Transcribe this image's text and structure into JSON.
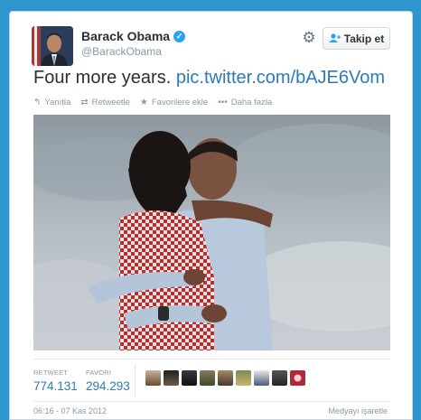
{
  "user": {
    "name": "Barack Obama",
    "handle": "@BarackObama",
    "verified_icon": "verified-badge-icon"
  },
  "header": {
    "follow_label": "Takip et",
    "gear_icon": "gear-icon"
  },
  "tweet": {
    "text": "Four more years.",
    "link": "pic.twitter.com/bAJE6Vom"
  },
  "actions": [
    {
      "icon": "reply-icon",
      "label": "Yanıtla"
    },
    {
      "icon": "retweet-icon",
      "label": "Retweetle"
    },
    {
      "icon": "star-icon",
      "label": "Favorilere ekle"
    },
    {
      "icon": "more-icon",
      "label": "Daha fazla"
    }
  ],
  "stats": {
    "retweet_label": "RETWEET",
    "retweet_count": "774.131",
    "favorite_label": "FAVORI",
    "favorite_count": "294.293"
  },
  "footer": {
    "timestamp": "06:16 - 07 Kas 2012",
    "report": "Medyayı işaretle"
  },
  "colors": {
    "background": "#2e95cf",
    "link": "#2b7bb9",
    "muted": "#8899a6"
  }
}
